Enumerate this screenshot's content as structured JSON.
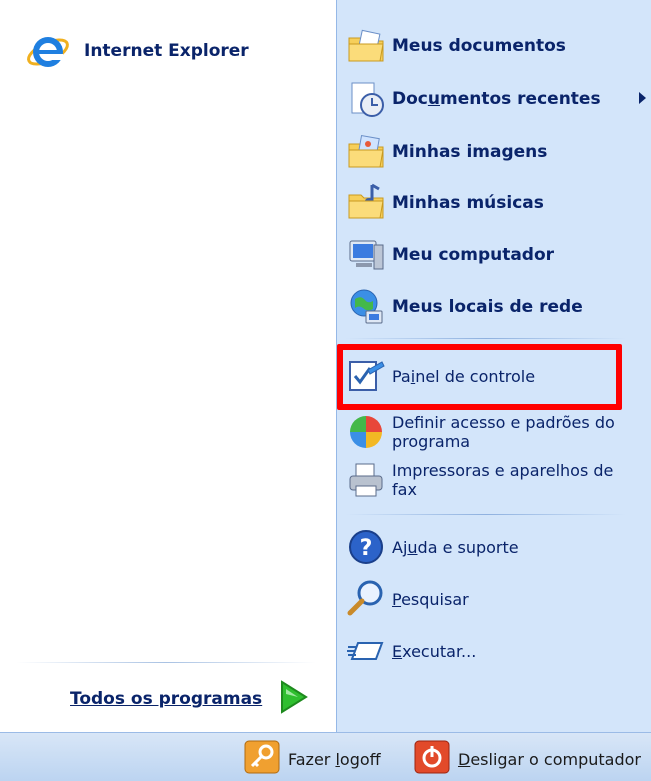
{
  "pinned": {
    "internet_explorer": "Internet Explorer"
  },
  "all_programs": "Todos os programas",
  "right": {
    "meus_documentos": "Meus documentos",
    "documentos_recentes_pre": "Doc",
    "documentos_recentes_u": "u",
    "documentos_recentes_post": "mentos recentes",
    "minhas_imagens": "Minhas imagens",
    "minhas_musicas": "Minhas músicas",
    "meu_computador": "Meu computador",
    "meus_locais_de_rede": "Meus locais de rede",
    "painel_pre": "Pa",
    "painel_u": "i",
    "painel_post": "nel de controle",
    "definir_line1": "Definir acesso e padrões do",
    "definir_line2": "programa",
    "impressoras_line1": "Impressoras e aparelhos de",
    "impressoras_line2": "fax",
    "ajuda_pre": "Aj",
    "ajuda_u": "u",
    "ajuda_post": "da e suporte",
    "pesquisar_pre": "",
    "pesquisar_u": "P",
    "pesquisar_post": "esquisar",
    "executar_pre": "",
    "executar_u": "E",
    "executar_post": "xecutar..."
  },
  "bottom": {
    "logoff_pre": "Fazer ",
    "logoff_u": "l",
    "logoff_post": "ogoff",
    "shutdown_pre": "",
    "shutdown_u": "D",
    "shutdown_post": "esligar o computador"
  },
  "colors": {
    "accent_text": "#0a246a",
    "right_panel": "#d3e5fa",
    "highlight": "#ff0000"
  }
}
